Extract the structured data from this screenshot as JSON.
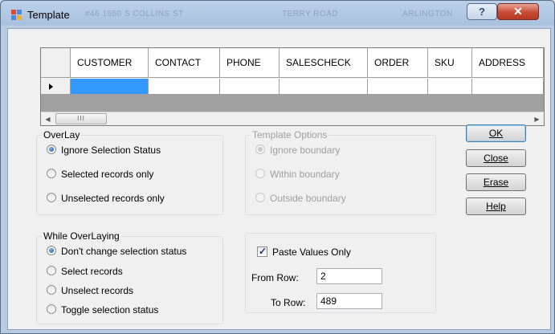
{
  "window": {
    "title": "Template",
    "ghost_text": [
      "#46 1650 S COLLINS ST",
      "TERRY ROAD",
      "ARLINGTON"
    ],
    "help_label": "?",
    "close_label": "✕"
  },
  "grid": {
    "columns": [
      "CUSTOMER",
      "CONTACT",
      "PHONE",
      "SALESCHECK",
      "ORDER",
      "SKU",
      "ADDRESS"
    ],
    "rows": [
      [
        "",
        "",
        "",
        "",
        "",
        "",
        ""
      ]
    ],
    "scroll_thumb": "III"
  },
  "overlay": {
    "label": "OverLay",
    "options": [
      {
        "label": "Ignore Selection Status",
        "checked": true
      },
      {
        "label": "Selected records only",
        "checked": false
      },
      {
        "label": "Unselected records only",
        "checked": false
      }
    ]
  },
  "template_options": {
    "label": "Template Options",
    "enabled": false,
    "options": [
      {
        "label": "Ignore boundary",
        "checked": true
      },
      {
        "label": "Within boundary",
        "checked": false
      },
      {
        "label": "Outside boundary",
        "checked": false
      }
    ]
  },
  "while_overlaying": {
    "label": "While OverLaying",
    "options": [
      {
        "label": "Don't change selection status",
        "checked": true
      },
      {
        "label": "Select records",
        "checked": false
      },
      {
        "label": "Unselect records",
        "checked": false
      },
      {
        "label": "Toggle selection status",
        "checked": false
      }
    ]
  },
  "paste": {
    "paste_values_label": "Paste Values Only",
    "paste_values_checked": true,
    "from_row_label": "From Row:",
    "from_row_value": "2",
    "to_row_label": "To Row:",
    "to_row_value": "489"
  },
  "buttons": {
    "ok": "OK",
    "close": "Close",
    "erase": "Erase",
    "help": "Help"
  },
  "colors": {
    "selection": "#3399ff",
    "title_bar": "#a9c1df",
    "close_button": "#c84a33"
  }
}
